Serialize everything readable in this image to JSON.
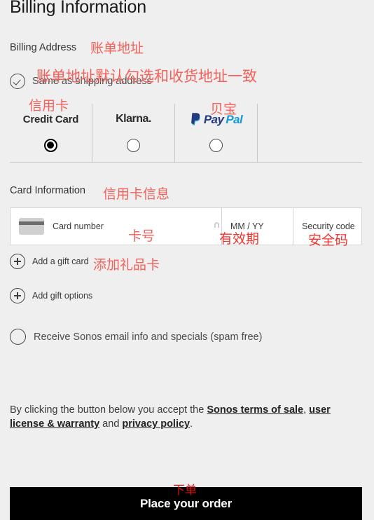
{
  "page": {
    "title": "Billing Information",
    "background_color": "#efefef"
  },
  "billing_address": {
    "label": "Billing Address",
    "same_as_shipping_label": "Same as shipping address",
    "same_as_shipping_checked": true,
    "check_icon": "check-circle-icon"
  },
  "payment_methods": {
    "selected": "Credit Card",
    "tabs": [
      {
        "label": "Credit Card",
        "selected": true
      },
      {
        "label": "Klarna.",
        "selected": false
      },
      {
        "label": "PayPal",
        "logo_pay": "Pay",
        "logo_pal": "Pal",
        "selected": false
      }
    ],
    "paypal_colors": {
      "pay": "#253b80",
      "pal": "#179bd7"
    }
  },
  "card_information": {
    "label": "Card Information",
    "card_number_placeholder": "Card number",
    "card_number_value": "",
    "expiry_placeholder": "MM / YY",
    "expiry_value": "",
    "security_code_placeholder": "Security code",
    "security_code_value": "",
    "card_icon": "credit-card-icon",
    "lock_icon": "lock-icon"
  },
  "options": {
    "add_gift_card": "Add a gift card",
    "add_gift_options": "Add gift options",
    "plus_icon": "circle-plus-icon",
    "email_optin_label": "Receive Sonos email info and specials (spam free)",
    "email_optin_checked": false
  },
  "terms": {
    "lead": "By clicking the button below you accept the ",
    "link_terms": "Sonos terms of sale",
    "comma": ",",
    "link_license": "user license & warranty",
    "and": " and ",
    "link_privacy": "privacy policy",
    "period": "."
  },
  "order_button": {
    "label": "Place your order",
    "background_color": "#000000",
    "text_color": "#ffffff"
  },
  "annotations": {
    "color": "#f5605a",
    "color_strong": "#e01010",
    "billing_address": "账单地址",
    "same_as_shipping": "账单地址默认勾选和收货地址一致",
    "credit_card": "信用卡",
    "paypal": "贝宝",
    "card_information": "信用卡信息",
    "card_number": "卡号",
    "expiry": "有效期",
    "security_code": "安全码",
    "gift_card": "添加礼品卡",
    "place_order": "下单"
  }
}
